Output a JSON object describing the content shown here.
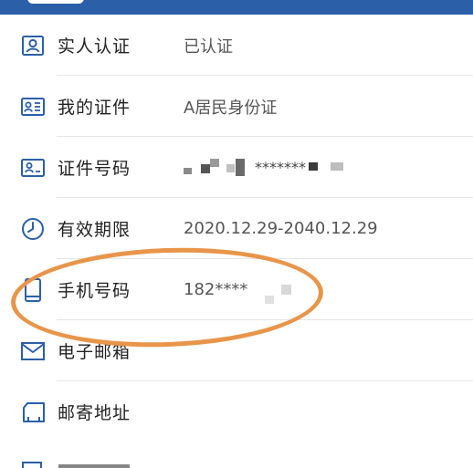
{
  "rows": [
    {
      "label": "实人认证",
      "value": "已认证",
      "icon": "id-card-person-icon"
    },
    {
      "label": "我的证件",
      "value": "A居民身份证",
      "icon": "id-card-lines-icon"
    },
    {
      "label": "证件号码",
      "value": "*******",
      "icon": "id-card-number-icon"
    },
    {
      "label": "有效期限",
      "value": "2020.12.29-2040.12.29",
      "icon": "clock-icon"
    },
    {
      "label": "手机号码",
      "value": "182****",
      "icon": "phone-icon"
    },
    {
      "label": "电子邮箱",
      "value": "",
      "icon": "mail-icon"
    },
    {
      "label": "邮寄地址",
      "value": "",
      "icon": "address-tag-icon"
    }
  ],
  "colors": {
    "accent": "#2b5fa8",
    "highlight": "#e8954a"
  }
}
